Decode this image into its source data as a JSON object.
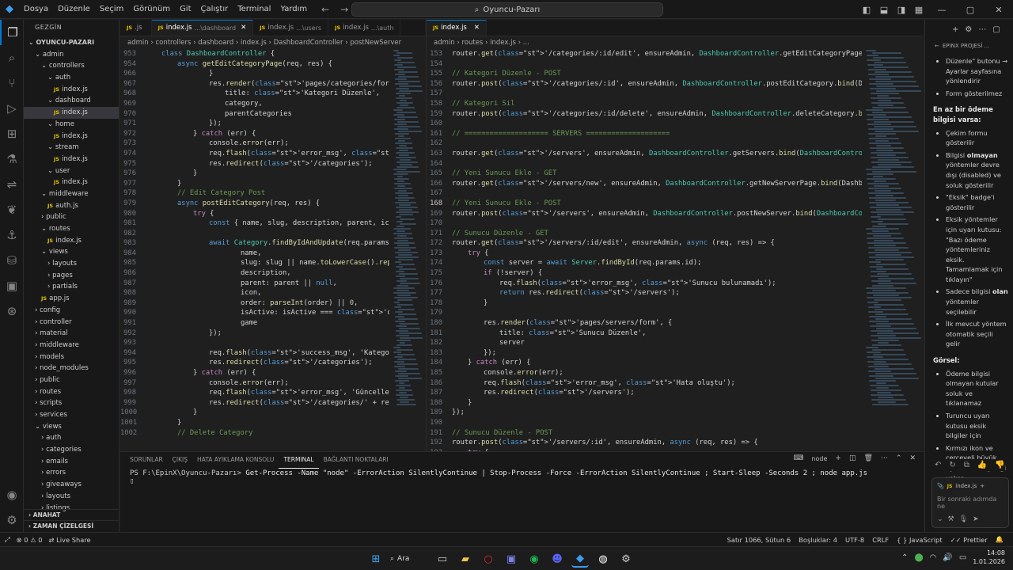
{
  "menu": [
    "Dosya",
    "Düzenle",
    "Seçim",
    "Görünüm",
    "Git",
    "Çalıştır",
    "Terminal",
    "Yardım"
  ],
  "search": {
    "label": "Oyuncu-Pazarı"
  },
  "sidebar": {
    "title": "GEZGİN",
    "root": "OYUNCU-PAZARI",
    "items": [
      {
        "label": "admin",
        "d": 1,
        "t": "f"
      },
      {
        "label": "controllers",
        "d": 2,
        "t": "f"
      },
      {
        "label": "auth",
        "d": 3,
        "t": "f"
      },
      {
        "label": "index.js",
        "d": 4,
        "t": "j"
      },
      {
        "label": "dashboard",
        "d": 3,
        "t": "f"
      },
      {
        "label": "index.js",
        "d": 4,
        "t": "j",
        "sel": true
      },
      {
        "label": "home",
        "d": 3,
        "t": "f"
      },
      {
        "label": "index.js",
        "d": 4,
        "t": "j"
      },
      {
        "label": "stream",
        "d": 3,
        "t": "f"
      },
      {
        "label": "index.js",
        "d": 4,
        "t": "j"
      },
      {
        "label": "user",
        "d": 3,
        "t": "f"
      },
      {
        "label": "index.js",
        "d": 4,
        "t": "j"
      },
      {
        "label": "middleware",
        "d": 2,
        "t": "f"
      },
      {
        "label": "auth.js",
        "d": 3,
        "t": "j"
      },
      {
        "label": "public",
        "d": 2,
        "t": "c"
      },
      {
        "label": "routes",
        "d": 2,
        "t": "f"
      },
      {
        "label": "index.js",
        "d": 3,
        "t": "j"
      },
      {
        "label": "views",
        "d": 2,
        "t": "f"
      },
      {
        "label": "layouts",
        "d": 3,
        "t": "c"
      },
      {
        "label": "pages",
        "d": 3,
        "t": "c"
      },
      {
        "label": "partials",
        "d": 3,
        "t": "c"
      },
      {
        "label": "app.js",
        "d": 2,
        "t": "j"
      },
      {
        "label": "config",
        "d": 1,
        "t": "c"
      },
      {
        "label": "controller",
        "d": 1,
        "t": "c"
      },
      {
        "label": "material",
        "d": 1,
        "t": "c"
      },
      {
        "label": "middleware",
        "d": 1,
        "t": "c"
      },
      {
        "label": "models",
        "d": 1,
        "t": "c"
      },
      {
        "label": "node_modules",
        "d": 1,
        "t": "c"
      },
      {
        "label": "public",
        "d": 1,
        "t": "c"
      },
      {
        "label": "routes",
        "d": 1,
        "t": "c"
      },
      {
        "label": "scripts",
        "d": 1,
        "t": "c"
      },
      {
        "label": "services",
        "d": 1,
        "t": "c"
      },
      {
        "label": "views",
        "d": 1,
        "t": "f"
      },
      {
        "label": "auth",
        "d": 2,
        "t": "c"
      },
      {
        "label": "categories",
        "d": 2,
        "t": "c"
      },
      {
        "label": "emails",
        "d": 2,
        "t": "c"
      },
      {
        "label": "errors",
        "d": 2,
        "t": "c"
      },
      {
        "label": "giveaways",
        "d": 2,
        "t": "c"
      },
      {
        "label": "layouts",
        "d": 2,
        "t": "c"
      },
      {
        "label": "listings",
        "d": 2,
        "t": "c"
      }
    ],
    "outline": "ANAHAT",
    "timeline": "ZAMAN ÇİZELGESİ"
  },
  "left_editor": {
    "tabs": [
      {
        "label": ".js",
        "sub": "",
        "active": false
      },
      {
        "label": "index.js",
        "sub": "...\\dashboard",
        "active": true
      },
      {
        "label": "index.js",
        "sub": "...\\users",
        "active": false
      },
      {
        "label": "index.js",
        "sub": "...\\auth",
        "active": false
      }
    ],
    "breadcrumb": [
      "admin",
      "controllers",
      "dashboard",
      "index.js",
      "DashboardController",
      "postNewServer"
    ],
    "lines": [
      {
        "n": "953",
        "c": "class DashboardController {",
        "i": 1
      },
      {
        "n": "954",
        "c": "async getEditCategoryPage(req, res) {",
        "i": 2
      },
      {
        "n": "966",
        "c": "}",
        "i": 4
      },
      {
        "n": "967",
        "c": "res.render('pages/categories/form', {",
        "i": 4
      },
      {
        "n": "968",
        "c": "title: 'Kategori Düzenle',",
        "i": 5
      },
      {
        "n": "969",
        "c": "category,",
        "i": 5
      },
      {
        "n": "970",
        "c": "parentCategories",
        "i": 5
      },
      {
        "n": "971",
        "c": "});",
        "i": 4
      },
      {
        "n": "972",
        "c": "} catch (err) {",
        "i": 3
      },
      {
        "n": "973",
        "c": "console.error(err);",
        "i": 4
      },
      {
        "n": "974",
        "c": "req.flash('error_msg', 'Hata oluştu');",
        "i": 4
      },
      {
        "n": "975",
        "c": "res.redirect('/categories');",
        "i": 4
      },
      {
        "n": "976",
        "c": "}",
        "i": 3
      },
      {
        "n": "977",
        "c": "}",
        "i": 2
      },
      {
        "n": "978",
        "c": "// Edit Category Post",
        "i": 2
      },
      {
        "n": "979",
        "c": "async postEditCategory(req, res) {",
        "i": 2
      },
      {
        "n": "980",
        "c": "try {",
        "i": 3
      },
      {
        "n": "981",
        "c": "const { name, slug, description, parent, ic",
        "i": 4
      },
      {
        "n": "982",
        "c": "",
        "i": 0
      },
      {
        "n": "983",
        "c": "await Category.findByIdAndUpdate(req.params",
        "i": 4
      },
      {
        "n": "984",
        "c": "name,",
        "i": 6
      },
      {
        "n": "985",
        "c": "slug: slug || name.toLowerCase().replac",
        "i": 6
      },
      {
        "n": "986",
        "c": "description,",
        "i": 6
      },
      {
        "n": "987",
        "c": "parent: parent || null,",
        "i": 6
      },
      {
        "n": "988",
        "c": "icon,",
        "i": 6
      },
      {
        "n": "989",
        "c": "order: parseInt(order) || 0,",
        "i": 6
      },
      {
        "n": "990",
        "c": "isActive: isActive === 'on',",
        "i": 6
      },
      {
        "n": "991",
        "c": "game",
        "i": 6
      },
      {
        "n": "992",
        "c": "});",
        "i": 4
      },
      {
        "n": "993",
        "c": "",
        "i": 0
      },
      {
        "n": "994",
        "c": "req.flash('success_msg', 'Kategori güncelle",
        "i": 4
      },
      {
        "n": "995",
        "c": "res.redirect('/categories');",
        "i": 4
      },
      {
        "n": "996",
        "c": "} catch (err) {",
        "i": 3
      },
      {
        "n": "997",
        "c": "console.error(err);",
        "i": 4
      },
      {
        "n": "998",
        "c": "req.flash('error_msg', 'Güncelleme sırasınd",
        "i": 4
      },
      {
        "n": "999",
        "c": "res.redirect('/categories/' + req.params.id",
        "i": 4
      },
      {
        "n": "1000",
        "c": "}",
        "i": 3
      },
      {
        "n": "1001",
        "c": "}",
        "i": 2
      },
      {
        "n": "1002",
        "c": "// Delete Category",
        "i": 2
      }
    ]
  },
  "right_editor": {
    "tabs": [
      {
        "label": "index.js",
        "sub": "",
        "active": true
      }
    ],
    "breadcrumb": [
      "admin",
      "routes",
      "index.js",
      "..."
    ],
    "lines": [
      {
        "n": "153",
        "c": "router.get('/categories/:id/edit', ensureAdmin, DashboardController.getEditCategoryPage.bind(Dash",
        "i": 0
      },
      {
        "n": "154",
        "c": "",
        "i": 0
      },
      {
        "n": "155",
        "c": "// Kategori Düzenle - POST",
        "i": 0
      },
      {
        "n": "156",
        "c": "router.post('/categories/:id', ensureAdmin, DashboardController.postEditCategory.bind(DashboardCo",
        "i": 0
      },
      {
        "n": "157",
        "c": "",
        "i": 0
      },
      {
        "n": "158",
        "c": "// Kategori Sil",
        "i": 0
      },
      {
        "n": "159",
        "c": "router.post('/categories/:id/delete', ensureAdmin, DashboardController.deleteCategory.bind(Dashbo",
        "i": 0
      },
      {
        "n": "160",
        "c": "",
        "i": 0
      },
      {
        "n": "161",
        "c": "// ==================== SERVERS ====================",
        "i": 0
      },
      {
        "n": "162",
        "c": "",
        "i": 0
      },
      {
        "n": "163",
        "c": "router.get('/servers', ensureAdmin, DashboardController.getServers.bind(DashboardController));",
        "i": 0
      },
      {
        "n": "164",
        "c": "",
        "i": 0
      },
      {
        "n": "165",
        "c": "// Yeni Sunucu Ekle - GET",
        "i": 0
      },
      {
        "n": "166",
        "c": "router.get('/servers/new', ensureAdmin, DashboardController.getNewServerPage.bind(DashboardContro",
        "i": 0
      },
      {
        "n": "167",
        "c": "",
        "i": 0
      },
      {
        "n": "168",
        "c": "// Yeni Sunucu Ekle - POST",
        "i": 0
      },
      {
        "n": "169",
        "c": "router.post('/servers', ensureAdmin, DashboardController.postNewServer.bind(DashboardController))",
        "i": 0
      },
      {
        "n": "170",
        "c": "",
        "i": 0
      },
      {
        "n": "171",
        "c": "// Sunucu Düzenle - GET",
        "i": 0
      },
      {
        "n": "172",
        "c": "router.get('/servers/:id/edit', ensureAdmin, async (req, res) => {",
        "i": 0
      },
      {
        "n": "173",
        "c": "try {",
        "i": 1
      },
      {
        "n": "174",
        "c": "const server = await Server.findById(req.params.id);",
        "i": 2
      },
      {
        "n": "175",
        "c": "if (!server) {",
        "i": 2
      },
      {
        "n": "176",
        "c": "req.flash('error_msg', 'Sunucu bulunamadı');",
        "i": 3
      },
      {
        "n": "177",
        "c": "return res.redirect('/servers');",
        "i": 3
      },
      {
        "n": "178",
        "c": "}",
        "i": 2
      },
      {
        "n": "179",
        "c": "",
        "i": 0
      },
      {
        "n": "180",
        "c": "res.render('pages/servers/form', {",
        "i": 2
      },
      {
        "n": "181",
        "c": "title: 'Sunucu Düzenle',",
        "i": 3
      },
      {
        "n": "182",
        "c": "server",
        "i": 3
      },
      {
        "n": "183",
        "c": "});",
        "i": 2
      },
      {
        "n": "184",
        "c": "} catch (err) {",
        "i": 1
      },
      {
        "n": "185",
        "c": "console.error(err);",
        "i": 2
      },
      {
        "n": "186",
        "c": "req.flash('error_msg', 'Hata oluştu');",
        "i": 2
      },
      {
        "n": "187",
        "c": "res.redirect('/servers');",
        "i": 2
      },
      {
        "n": "188",
        "c": "}",
        "i": 1
      },
      {
        "n": "189",
        "c": "});",
        "i": 0
      },
      {
        "n": "190",
        "c": "",
        "i": 0
      },
      {
        "n": "191",
        "c": "// Sunucu Düzenle - POST",
        "i": 0
      },
      {
        "n": "192",
        "c": "router.post('/servers/:id', ensureAdmin, async (req, res) => {",
        "i": 0
      },
      {
        "n": "193",
        "c": "try {",
        "i": 1
      }
    ]
  },
  "panel": {
    "tabs": [
      "SORUNLAR",
      "ÇIKIŞ",
      "HATA AYIKLAMA KONSOLU",
      "TERMINAL",
      "BAĞLANTI NOKTALARI"
    ],
    "active_tab": "TERMINAL",
    "shell": "node",
    "prompt": "PS F:\\EpinX\\Oyuncu-Pazarı>",
    "command": "Get-Process -Name \"node\" -ErrorAction SilentlyContinue | Stop-Process -Force -ErrorAction SilentlyContinue ; Start-Sleep -Seconds 2 ; node app.js"
  },
  "chat": {
    "title": "EPINX PROJESİ ...",
    "intro_items": [
      "Düzenle\" butonu → Ayarlar sayfasına yönlendirir",
      "Form gösterilmez"
    ],
    "section1_heading": "En az bir ödeme bilgisi varsa:",
    "section1_items": [
      {
        "pre": "Çekim formu gösterilir",
        "b": "",
        "post": ""
      },
      {
        "pre": "Bilgisi ",
        "b": "olmayan",
        "post": " yöntemler devre dışı (disabled) ve soluk gösterilir"
      },
      {
        "pre": "\"Eksik\" badge'i gösterilir",
        "b": "",
        "post": ""
      },
      {
        "pre": "Eksik yöntemler için uyarı kutusu: \"Bazı ödeme yöntemleriniz eksik. Tamamlamak için tıklayın\"",
        "b": "",
        "post": ""
      },
      {
        "pre": "Sadece bilgisi ",
        "b": "olan",
        "post": " yöntemler seçilebilir"
      },
      {
        "pre": "İlk mevcut yöntem otomatik seçili gelir",
        "b": "",
        "post": ""
      }
    ],
    "section2_heading": "Görsel:",
    "section2_items": [
      "Ödeme bilgisi olmayan kutular soluk ve tıklanamaz",
      "Turuncu uyarı kutusu eksik bilgiler için",
      "Kırmızı ikon ve çerçeveli büyük uyarı kartı hiç bilgi yoksa"
    ],
    "context_file": "index.js",
    "placeholder": "Bir sonraki adımda ne"
  },
  "status": {
    "errors": "0",
    "warnings": "0",
    "live_share": "Live Share",
    "position": "Satır 1066, Sütun 6",
    "spaces": "Boşluklar: 4",
    "encoding": "UTF-8",
    "eol": "CRLF",
    "language": "JavaScript",
    "prettier": "Prettier"
  },
  "taskbar": {
    "search": "Ara",
    "time": "14:08",
    "date": "1.01.2026"
  },
  "colors": {
    "accent": "#0078d4",
    "js_badge": "#e6c300"
  }
}
